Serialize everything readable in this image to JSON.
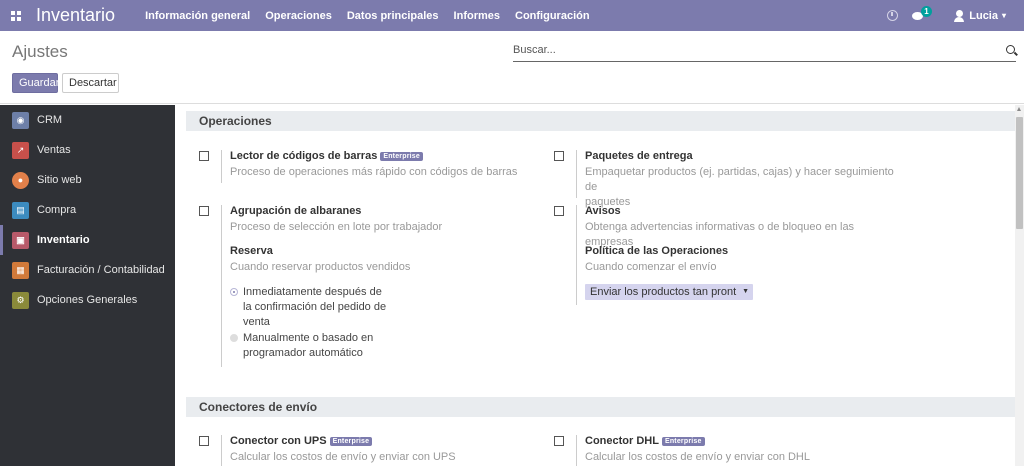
{
  "topbar": {
    "app_title": "Inventario",
    "menu": [
      "Información general",
      "Operaciones",
      "Datos principales",
      "Informes",
      "Configuración"
    ],
    "chat_badge": "1",
    "user_name": "Lucia",
    "accent_color": "#7c7bad"
  },
  "control": {
    "page_title": "Ajustes",
    "search_placeholder": "Buscar...",
    "save_label": "Guardar",
    "discard_label": "Descartar"
  },
  "sidebar": {
    "items": [
      {
        "label": "CRM",
        "icon": "crm-icon"
      },
      {
        "label": "Ventas",
        "icon": "sales-icon"
      },
      {
        "label": "Sitio web",
        "icon": "website-icon"
      },
      {
        "label": "Compra",
        "icon": "purchase-icon"
      },
      {
        "label": "Inventario",
        "icon": "inventory-icon",
        "active": true
      },
      {
        "label": "Facturación / Contabilidad",
        "icon": "invoicing-icon"
      },
      {
        "label": "Opciones Generales",
        "icon": "gear-icon"
      }
    ]
  },
  "operaciones": {
    "heading": "Operaciones",
    "barcode": {
      "title": "Lector de códigos de barras",
      "badge": "Enterprise",
      "desc": "Proceso de operaciones más rápido con códigos de barras",
      "checked": false
    },
    "packages": {
      "title": "Paquetes de entrega",
      "desc_line1": "Empaquetar productos (ej. partidas, cajas) y hacer seguimiento de",
      "desc_line2": "paquetes",
      "checked": false
    },
    "batch": {
      "title": "Agrupación de albaranes",
      "desc": "Proceso de selección en lote por trabajador",
      "checked": false
    },
    "warnings": {
      "title": "Avisos",
      "desc": "Obtenga advertencias informativas o de bloqueo en las empresas",
      "checked": false
    },
    "reserva": {
      "title": "Reserva",
      "desc": "Cuando reservar productos vendidos",
      "option1_lines": [
        "Inmediatamente después de",
        "la confirmación del pedido de",
        "venta"
      ],
      "option2_lines": [
        "Manualmente o basado en",
        "programador automático"
      ],
      "selected": 1
    },
    "policy": {
      "title": "Política de las Operaciones",
      "desc": "Cuando comenzar el envío",
      "select_value": "Enviar los productos tan pront"
    }
  },
  "conectores": {
    "heading": "Conectores de envío",
    "ups": {
      "title": "Conector con UPS",
      "badge": "Enterprise",
      "desc": "Calcular los costos de envío y enviar con UPS",
      "checked": false
    },
    "dhl": {
      "title": "Conector DHL",
      "badge": "Enterprise",
      "desc": "Calcular los costos de envío y enviar con DHL",
      "checked": false
    }
  }
}
